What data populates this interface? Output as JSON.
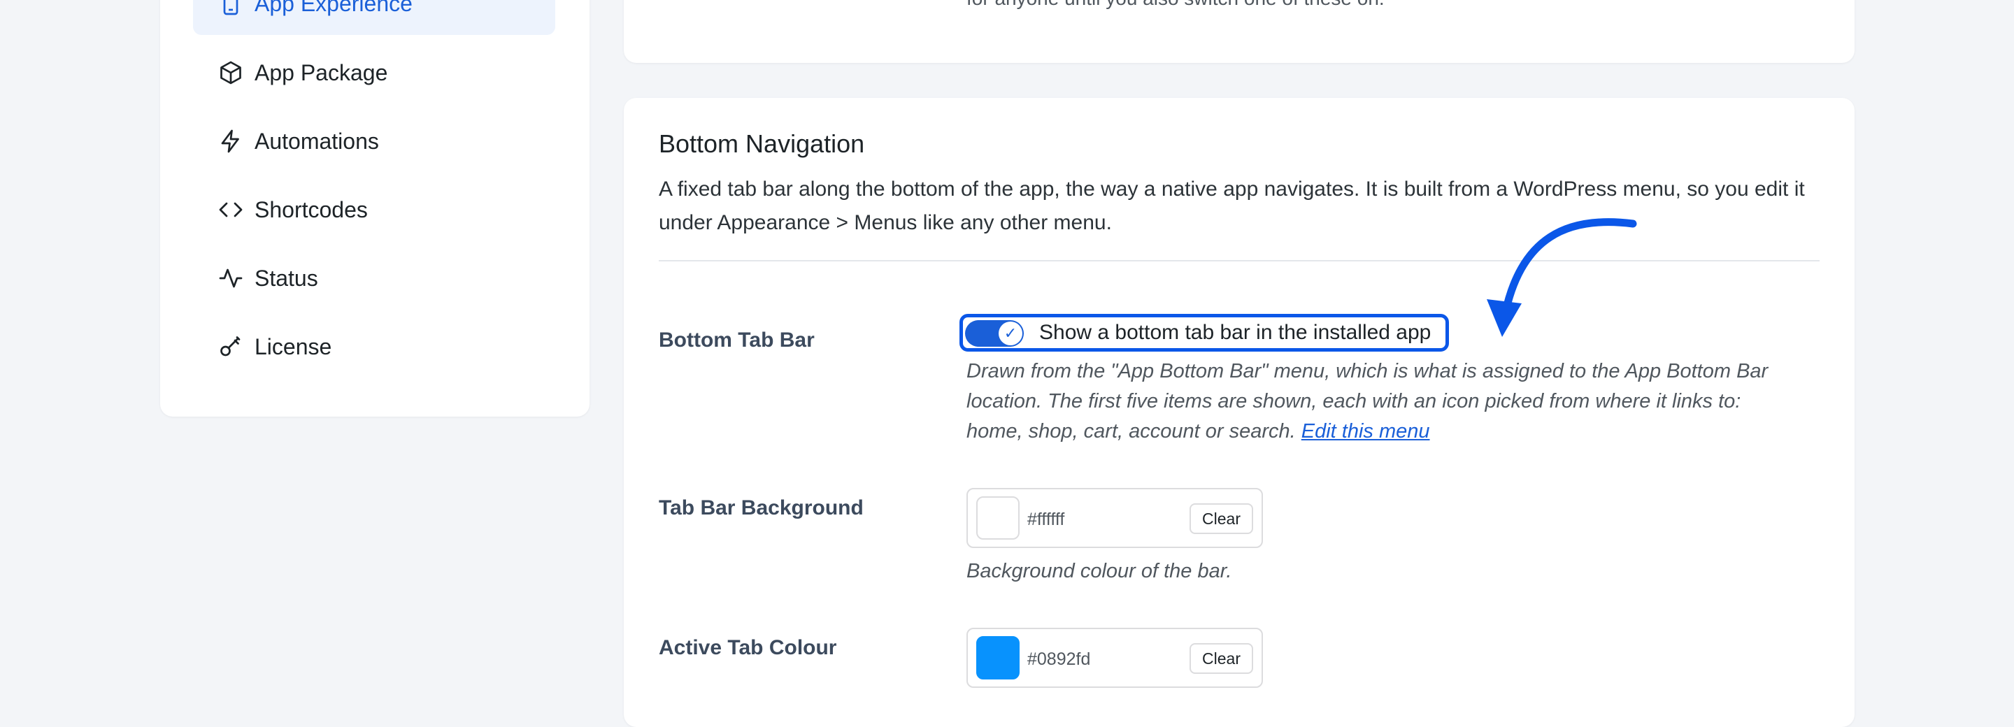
{
  "sidebar": {
    "items": [
      {
        "label": "App Experience",
        "icon": "mobile-icon",
        "active": true
      },
      {
        "label": "App Package",
        "icon": "cube-icon"
      },
      {
        "label": "Automations",
        "icon": "bolt-icon"
      },
      {
        "label": "Shortcodes",
        "icon": "code-icon"
      },
      {
        "label": "Status",
        "icon": "activity-icon"
      },
      {
        "label": "License",
        "icon": "key-icon"
      }
    ]
  },
  "top_card": {
    "text": "for anyone until you also switch one of these on."
  },
  "bottom_navigation": {
    "title": "Bottom Navigation",
    "description": "A fixed tab bar along the bottom of the app, the way a native app navigates. It is built from a WordPress menu, so you edit it under Appearance > Menus like any other menu.",
    "tab_bar": {
      "label": "Bottom Tab Bar",
      "toggle_label": "Show a bottom tab bar in the installed app",
      "enabled": true,
      "help_line1": "Drawn from the \"App Bottom Bar\" menu, which is what is assigned to the App Bottom Bar",
      "help_line2": "location. The first five items are shown, each with an icon picked from where it links to:",
      "help_line3": "home, shop, cart, account or search.",
      "help_link": "Edit this menu"
    },
    "background": {
      "label": "Tab Bar Background",
      "value": "#ffffff",
      "clear_label": "Clear",
      "help": "Background colour of the bar."
    },
    "active_tab": {
      "label": "Active Tab Colour",
      "value": "#0892fd",
      "clear_label": "Clear"
    }
  },
  "colors": {
    "accent": "#1a5fd8",
    "annotation": "#0b57e8"
  }
}
